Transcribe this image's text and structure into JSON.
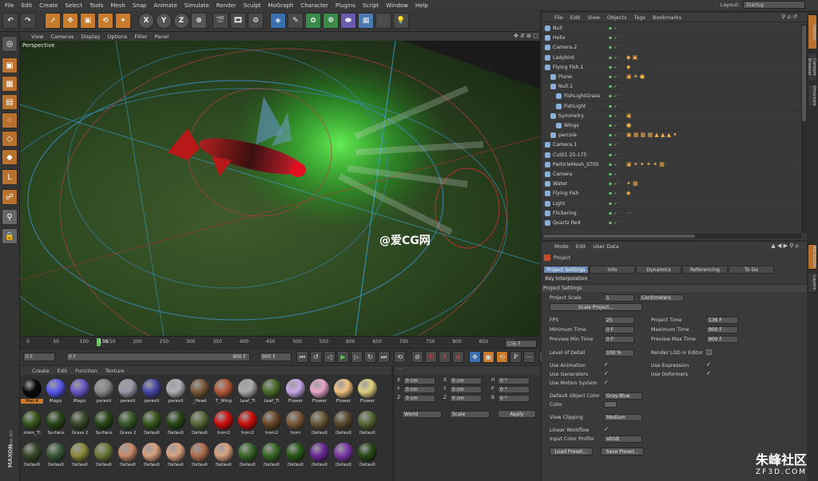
{
  "menubar": {
    "items": [
      "File",
      "Edit",
      "Create",
      "Select",
      "Tools",
      "Mesh",
      "Snap",
      "Animate",
      "Simulate",
      "Render",
      "Sculpt",
      "MoGraph",
      "Character",
      "Plugins",
      "Script",
      "Window",
      "Help"
    ],
    "layout_label": "Layout:",
    "layout_value": "Startup"
  },
  "toolbar": {
    "axis_x": "X",
    "axis_y": "Y",
    "axis_z": "Z"
  },
  "viewport": {
    "menu": [
      "View",
      "Cameras",
      "Display",
      "Options",
      "Filter",
      "Panel"
    ],
    "label": "Perspective"
  },
  "timeline": {
    "ticks": [
      "0",
      "50",
      "100",
      "136",
      "150",
      "200",
      "250",
      "300",
      "350",
      "400",
      "450",
      "500",
      "550",
      "600",
      "650",
      "700",
      "750",
      "800",
      "850",
      "900"
    ],
    "current_frame": "136 F"
  },
  "transport": {
    "start": "0 F",
    "slider_start": "0 F",
    "slider_end": "900 F",
    "end": "900 F"
  },
  "materials": {
    "menu": [
      "Create",
      "Edit",
      "Function",
      "Texture"
    ],
    "items": [
      {
        "label": "Mat.4",
        "color": "#0a0a0a"
      },
      {
        "label": "Magic",
        "color": "#5a5af0"
      },
      {
        "label": "Magic",
        "color": "#6a5ac8"
      },
      {
        "label": "pareoli",
        "color": "#888"
      },
      {
        "label": "pareoli",
        "color": "#9a9aa8"
      },
      {
        "label": "pareoli",
        "color": "#4a4aa8"
      },
      {
        "label": "pareoli",
        "color": "#b0b0b8"
      },
      {
        "label": "_Head",
        "color": "#7a5a3a"
      },
      {
        "label": "T_Wing",
        "color": "#b55a3a"
      },
      {
        "label": "Leaf_Tl",
        "color": "#aaa"
      },
      {
        "label": "Leaf_Tl",
        "color": "#4a6a2a"
      },
      {
        "label": "Flower",
        "color": "#c8a8e8"
      },
      {
        "label": "Flower",
        "color": "#e8a8c8"
      },
      {
        "label": "Flower",
        "color": "#f0c080"
      },
      {
        "label": "Flower",
        "color": "#e0d080"
      },
      {
        "label": "stem_Tl",
        "color": "#3a5a20"
      },
      {
        "label": "Surface",
        "color": "#2a4a1a"
      },
      {
        "label": "Grass 2",
        "color": "#3a4a2a"
      },
      {
        "label": "Surface",
        "color": "#2a4a1a"
      },
      {
        "label": "Grass 2",
        "color": "#3a5a2a"
      },
      {
        "label": "Default",
        "color": "#3a5a20"
      },
      {
        "label": "Default",
        "color": "#2a4a1a"
      },
      {
        "label": "Default",
        "color": "#5a6a3a"
      },
      {
        "label": "horn2",
        "color": "#d01010"
      },
      {
        "label": "horn2",
        "color": "#d01010"
      },
      {
        "label": "horn2",
        "color": "#6a4a2a"
      },
      {
        "label": "horn",
        "color": "#7a5a3a"
      },
      {
        "label": "Default",
        "color": "#6a5a3a"
      },
      {
        "label": "Default",
        "color": "#5a4a30"
      },
      {
        "label": "Default",
        "color": "#5a6a3a"
      },
      {
        "label": "Default",
        "color": "#3a4a2a"
      },
      {
        "label": "Default",
        "color": "#3a5a3a"
      },
      {
        "label": "Default",
        "color": "#8a8a3a"
      },
      {
        "label": "Default",
        "color": "#6a7a3a"
      },
      {
        "label": "Default",
        "color": "#c88a6a"
      },
      {
        "label": "Default",
        "color": "#d8a080"
      },
      {
        "label": "Default",
        "color": "#d8a080"
      },
      {
        "label": "Default",
        "color": "#b07050"
      },
      {
        "label": "Default",
        "color": "#d8a080"
      },
      {
        "label": "Default",
        "color": "#3a6a2a"
      },
      {
        "label": "Default",
        "color": "#3a6a2a"
      },
      {
        "label": "Default",
        "color": "#2a5a1a"
      },
      {
        "label": "Default",
        "color": "#6a2a9a"
      },
      {
        "label": "Default",
        "color": "#7a3aaa"
      },
      {
        "label": "Default",
        "color": "#2a4a1a"
      }
    ]
  },
  "coords": {
    "rows": [
      {
        "a": "X",
        "av": "0 cm",
        "b": "X",
        "bv": "0 cm",
        "c": "H",
        "cv": "0 °"
      },
      {
        "a": "Y",
        "av": "0 cm",
        "b": "Y",
        "bv": "0 cm",
        "c": "P",
        "cv": "0 °"
      },
      {
        "a": "Z",
        "av": "0 cm",
        "b": "Z",
        "bv": "0 cm",
        "c": "B",
        "cv": "0 °"
      }
    ],
    "world": "World",
    "scale": "Scale",
    "apply": "Apply"
  },
  "objects": {
    "menu": [
      "File",
      "Edit",
      "View",
      "Objects",
      "Tags",
      "Bookmarks"
    ],
    "rows": [
      {
        "name": "Null",
        "indent": 0,
        "tags": ""
      },
      {
        "name": "Helix",
        "indent": 0,
        "tags": ""
      },
      {
        "name": "Camera.2",
        "indent": 0,
        "tags": ""
      },
      {
        "name": "Ladybird",
        "indent": 0,
        "tags": "◆ ▣"
      },
      {
        "name": "Flying Fish.1",
        "indent": 0,
        "tags": "◆"
      },
      {
        "name": "Plane",
        "indent": 1,
        "tags": "▣ ✦ ●"
      },
      {
        "name": "Null.1",
        "indent": 1,
        "tags": ""
      },
      {
        "name": "FishLightGrass",
        "indent": 2,
        "tags": ""
      },
      {
        "name": "FishLight",
        "indent": 2,
        "tags": ""
      },
      {
        "name": "Symmetry",
        "indent": 1,
        "tags": "▣"
      },
      {
        "name": "Wings",
        "indent": 2,
        "tags": "●"
      },
      {
        "name": "parcola",
        "indent": 1,
        "tags": "▣ ▦ ▦ ▦ ▲ ▲ ▲ ✦"
      },
      {
        "name": "Camera.1",
        "indent": 0,
        "tags": ""
      },
      {
        "name": "Cut01 25-175",
        "indent": 0,
        "tags": ""
      },
      {
        "name": "ParticleMesh_ST05",
        "indent": 0,
        "tags": "▣ ✦ ✦ ✦ ✦ ▦"
      },
      {
        "name": "Camera",
        "indent": 0,
        "tags": ""
      },
      {
        "name": "Water",
        "indent": 0,
        "tags": "✦ ▦"
      },
      {
        "name": "Flying Fish",
        "indent": 0,
        "tags": "◆"
      },
      {
        "name": "Light",
        "indent": 0,
        "tags": ""
      },
      {
        "name": "Flickering",
        "indent": 0,
        "tags": "⋯"
      },
      {
        "name": "Quartz Red",
        "indent": 0,
        "tags": ""
      }
    ]
  },
  "attributes": {
    "menu": [
      "Mode",
      "Edit",
      "User Data"
    ],
    "object": "Project",
    "tabs": [
      "Project Settings",
      "Info",
      "Dynamics",
      "Referencing",
      "To Do"
    ],
    "tab2": "Key Interpolation",
    "section": "Project Settings",
    "project_scale_label": "Project Scale",
    "project_scale_value": "1",
    "project_scale_unit": "Centimeters",
    "scale_project_btn": "Scale Project...",
    "fps_label": "FPS",
    "fps_value": "25",
    "project_time_label": "Project Time",
    "project_time_value": "136 F",
    "min_time_label": "Minimum Time",
    "min_time_value": "0 F",
    "max_time_label": "Maximum Time",
    "max_time_value": "900 F",
    "prev_min_label": "Preview Min Time",
    "prev_min_value": "0 F",
    "prev_max_label": "Preview Max Time",
    "prev_max_value": "900 F",
    "lod_label": "Level of Detail",
    "lod_value": "100 %",
    "render_lod_label": "Render LOD in Editor",
    "use_animation": "Use Animation",
    "use_expression": "Use Expression",
    "use_generators": "Use Generators",
    "use_deformers": "Use Deformers",
    "use_motion": "Use Motion System",
    "default_color_label": "Default Object Color",
    "default_color_value": "Gray-Blue",
    "color_label": "Color",
    "view_clipping_label": "View Clipping",
    "view_clipping_value": "Medium",
    "linear_workflow": "Linear Workflow",
    "input_color_label": "Input Color Profile",
    "input_color_value": "sRGB",
    "load_preset": "Load Preset...",
    "save_preset": "Save Preset..."
  },
  "side_tabs": [
    "Objects",
    "Content Browser",
    "Structure",
    "Attributes",
    "Layers"
  ],
  "brand": {
    "maxon": "MAXON",
    "cinema": "CINEMA 4D"
  },
  "watermark": {
    "cg": "@爱CG网",
    "site": "朱峰社区",
    "url": "ZF3D.COM"
  }
}
